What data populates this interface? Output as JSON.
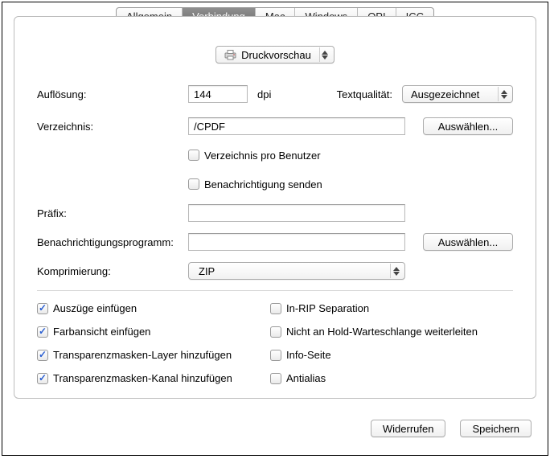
{
  "tabs": {
    "allgemein": "Allgemein",
    "verbindung": "Verbindung",
    "mac": "Mac",
    "windows": "Windows",
    "opi": "OPI",
    "icc": "ICC"
  },
  "mode_popup": "Druckvorschau",
  "labels": {
    "resolution": "Auflösung:",
    "dpi": "dpi",
    "textquality": "Textqualität:",
    "directory": "Verzeichnis:",
    "prefix": "Präfix:",
    "notify_prog": "Benachrichtigungsprogramm:",
    "compression": "Komprimierung:"
  },
  "values": {
    "resolution": "144",
    "textquality": "Ausgezeichnet",
    "directory": "/CPDF",
    "prefix": "",
    "notify_prog": "",
    "compression": "ZIP"
  },
  "buttons": {
    "choose": "Auswählen...",
    "choose2": "Auswählen...",
    "revert": "Widerrufen",
    "save": "Speichern"
  },
  "checkboxes": {
    "dir_per_user": "Verzeichnis pro Benutzer",
    "send_notification": "Benachrichtigung senden",
    "insert_extracts": "Auszüge einfügen",
    "insert_colorview": "Farbansicht einfügen",
    "add_trans_layer": "Transparenzmasken-Layer hinzufügen",
    "add_trans_channel": "Transparenzmasken-Kanal hinzufügen",
    "inrip": "In-RIP Separation",
    "no_hold": "Nicht an Hold-Warteschlange weiterleiten",
    "info_page": "Info-Seite",
    "antialias": "Antialias"
  }
}
